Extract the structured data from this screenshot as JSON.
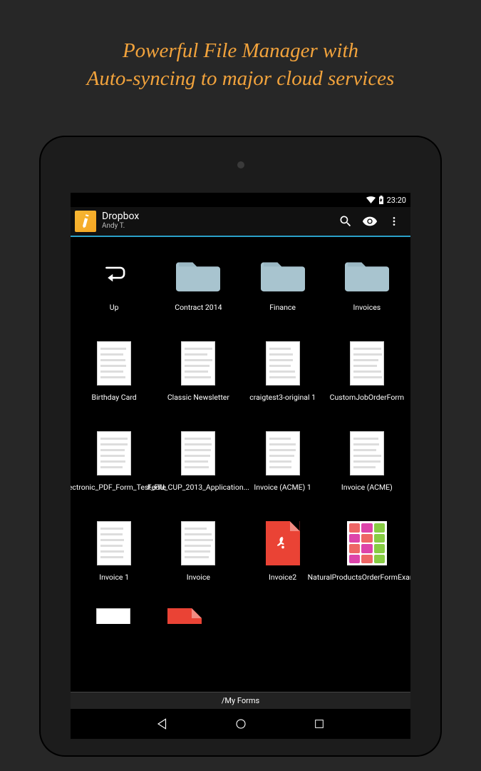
{
  "promo": {
    "line1": "Powerful File Manager with",
    "line2": "Auto-syncing to major cloud services"
  },
  "statusbar": {
    "time": "23:20"
  },
  "appbar": {
    "title": "Dropbox",
    "subtitle": "Andy T."
  },
  "grid": [
    {
      "type": "up",
      "label": "Up"
    },
    {
      "type": "folder",
      "label": "Contract 2014"
    },
    {
      "type": "folder",
      "label": "Finance"
    },
    {
      "type": "folder",
      "label": "Invoices"
    },
    {
      "type": "doc",
      "label": "Birthday Card"
    },
    {
      "type": "doc",
      "label": "Classic Newsletter"
    },
    {
      "type": "doc",
      "label": "craigtest3-original 1"
    },
    {
      "type": "doc",
      "label": "CustomJobOrderForm"
    },
    {
      "type": "doc",
      "label": "Electronic_PDF_Form_Test_File"
    },
    {
      "type": "doc",
      "label": "FedU_CUP_2013_Application..."
    },
    {
      "type": "doc",
      "label": "Invoice (ACME) 1"
    },
    {
      "type": "doc",
      "label": "Invoice (ACME)"
    },
    {
      "type": "doc",
      "label": "Invoice 1"
    },
    {
      "type": "doc",
      "label": "Invoice"
    },
    {
      "type": "pdf",
      "label": "Invoice2"
    },
    {
      "type": "collage",
      "label": "NaturalProductsOrderFormExample"
    }
  ],
  "footer": {
    "path": "/My Forms"
  },
  "icons": {
    "search": "search-icon",
    "eye": "eye-icon",
    "overflow": "overflow-icon",
    "wifi": "wifi-icon",
    "battery": "battery-icon"
  }
}
